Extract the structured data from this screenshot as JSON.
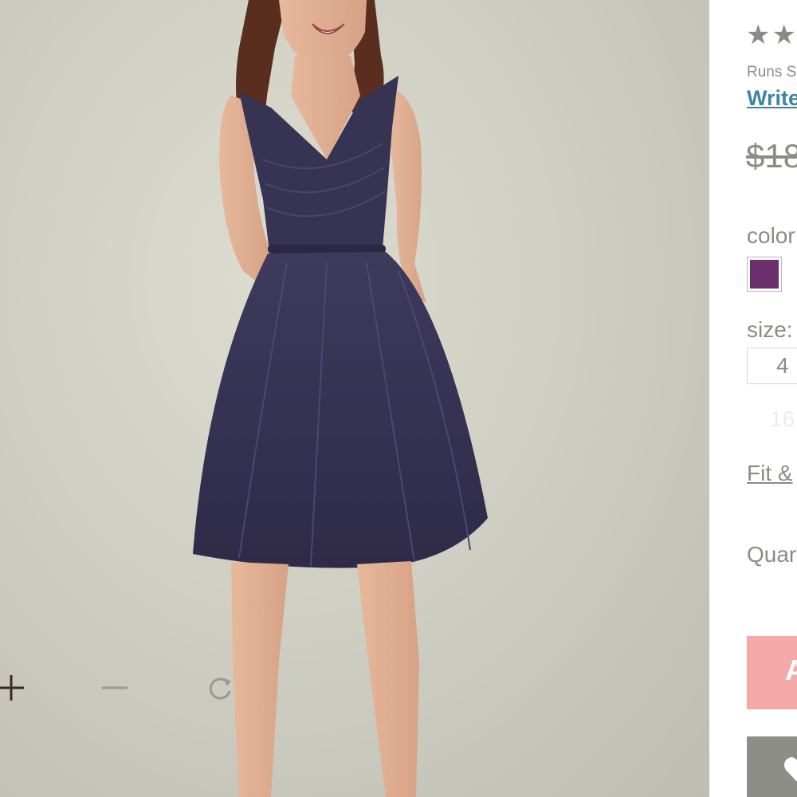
{
  "product_image": {
    "zoom_in_icon": "plus-icon",
    "zoom_out_icon": "minus-icon",
    "reset_icon": "rotate-icon"
  },
  "details": {
    "rating_stars": "★★",
    "runs_text": "Runs S",
    "write_review": "Write",
    "price": "$18",
    "color_label": "color",
    "selected_color": "#6b2f6d",
    "size_label": "size:",
    "size_selected": "4",
    "size_other": "16",
    "fit_link": "Fit &",
    "quantity_label": "Quar",
    "add_button_label": "A",
    "add_button_color": "#f5a8a8",
    "wishlist_icon": "heart-icon",
    "wishlist_button_color": "#8d8e87"
  }
}
